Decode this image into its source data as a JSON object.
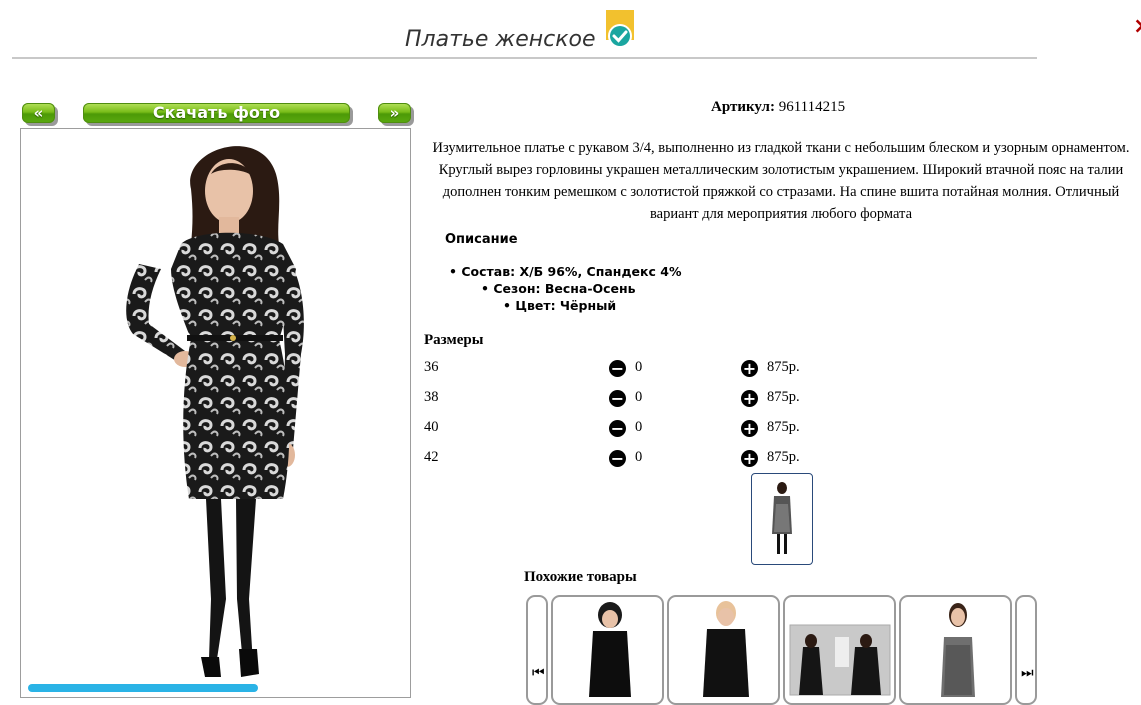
{
  "product": {
    "title": "Платье женское",
    "sku_label": "Артикул:",
    "sku_value": "961114215",
    "description": "Изумительное платье с рукавом 3/4, выполненно из гладкой ткани с небольшим блеском и узорным орнаментом. Круглый вырез горловины украшен металлическим золотистым украшением. Широкий втачной пояс на талии дополнен тонким ремешком с золотистой пряжкой со стразами. На спине вшита потайная молния. Отличный вариант для мероприятия любого формата",
    "specs_title": "Описание",
    "specs": [
      "Состав: Х/Б 96%, Спандекс 4%",
      "Сезон: Весна-Осень",
      "Цвет: Чёрный"
    ]
  },
  "gallery": {
    "prev_label": "«",
    "download_label": "Скачать фото",
    "next_label": "»"
  },
  "sizes": {
    "title": "Размеры",
    "rows": [
      {
        "size": "36",
        "qty": "0",
        "price": "875р."
      },
      {
        "size": "38",
        "qty": "0",
        "price": "875р."
      },
      {
        "size": "40",
        "qty": "0",
        "price": "875р."
      },
      {
        "size": "42",
        "qty": "0",
        "price": "875р."
      }
    ]
  },
  "similar": {
    "title": "Похожие товары",
    "prev_icon": "skip-back-icon",
    "next_icon": "skip-forward-icon"
  },
  "colors": {
    "accent_green": "#79bd19",
    "badge_yellow": "#f2c12e",
    "badge_teal": "#1aa6a0",
    "border_blue": "#2a4a7a"
  }
}
